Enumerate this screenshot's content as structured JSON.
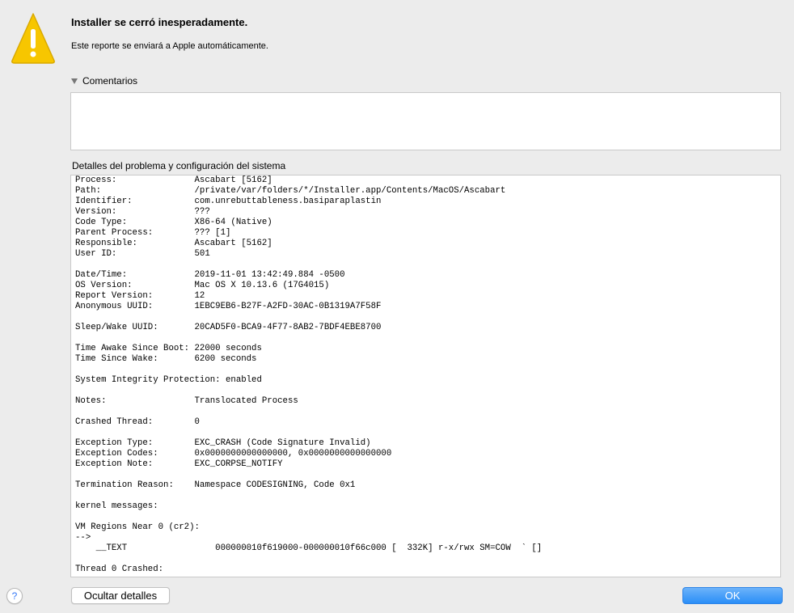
{
  "dialog": {
    "title": "Installer se cerró inesperadamente.",
    "subtitle": "Este reporte se enviará a Apple automáticamente.",
    "icon": "warning-triangle-icon"
  },
  "comments": {
    "label": "Comentarios",
    "value": ""
  },
  "details": {
    "label": "Detalles del problema y configuración del sistema",
    "lines": [
      "Process:               Ascabart [5162]",
      "Path:                  /private/var/folders/*/Installer.app/Contents/MacOS/Ascabart",
      "Identifier:            com.unrebuttableness.basiparaplastin",
      "Version:               ???",
      "Code Type:             X86-64 (Native)",
      "Parent Process:        ??? [1]",
      "Responsible:           Ascabart [5162]",
      "User ID:               501",
      "",
      "Date/Time:             2019-11-01 13:42:49.884 -0500",
      "OS Version:            Mac OS X 10.13.6 (17G4015)",
      "Report Version:        12",
      "Anonymous UUID:        1EBC9EB6-B27F-A2FD-30AC-0B1319A7F58F",
      "",
      "Sleep/Wake UUID:       20CAD5F0-BCA9-4F77-8AB2-7BDF4EBE8700",
      "",
      "Time Awake Since Boot: 22000 seconds",
      "Time Since Wake:       6200 seconds",
      "",
      "System Integrity Protection: enabled",
      "",
      "Notes:                 Translocated Process",
      "",
      "Crashed Thread:        0",
      "",
      "Exception Type:        EXC_CRASH (Code Signature Invalid)",
      "Exception Codes:       0x0000000000000000, 0x0000000000000000",
      "Exception Note:        EXC_CORPSE_NOTIFY",
      "",
      "Termination Reason:    Namespace CODESIGNING, Code 0x1",
      "",
      "kernel messages:",
      "",
      "VM Regions Near 0 (cr2):",
      "-->",
      "    __TEXT                 000000010f619000-000000010f66c000 [  332K] r-x/rwx SM=COW  ` []",
      "",
      "Thread 0 Crashed:"
    ]
  },
  "buttons": {
    "help": "?",
    "hide_details": "Ocultar detalles",
    "ok": "OK"
  },
  "colors": {
    "window_bg": "#ececec",
    "accent": "#2a8ef7",
    "warning": "#f7c600"
  }
}
